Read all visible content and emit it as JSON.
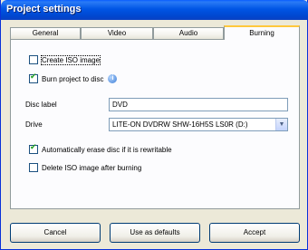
{
  "window": {
    "title": "Project settings"
  },
  "tabs": [
    "General",
    "Video",
    "Audio",
    "Burning"
  ],
  "burning": {
    "create_iso": {
      "label": "Create ISO image",
      "checked": false
    },
    "burn_project": {
      "label": "Burn project to disc",
      "checked": true,
      "info_icon": "info-icon"
    },
    "disc_label": {
      "label": "Disc label",
      "value": "DVD"
    },
    "drive": {
      "label": "Drive",
      "value": "LITE-ON DVDRW SHW-16H5S LS0R (D:)"
    },
    "auto_erase": {
      "label": "Automatically erase disc if it is rewritable",
      "checked": true
    },
    "delete_iso": {
      "label": "Delete ISO image after burning",
      "checked": false
    }
  },
  "buttons": {
    "cancel": "Cancel",
    "defaults": "Use as defaults",
    "accept": "Accept"
  },
  "colors": {
    "title_bar": "#0055e5",
    "dialog_bg": "#ece9d8",
    "panel_bg": "#fcfcfe",
    "active_tab_accent": "#ffc83c"
  }
}
